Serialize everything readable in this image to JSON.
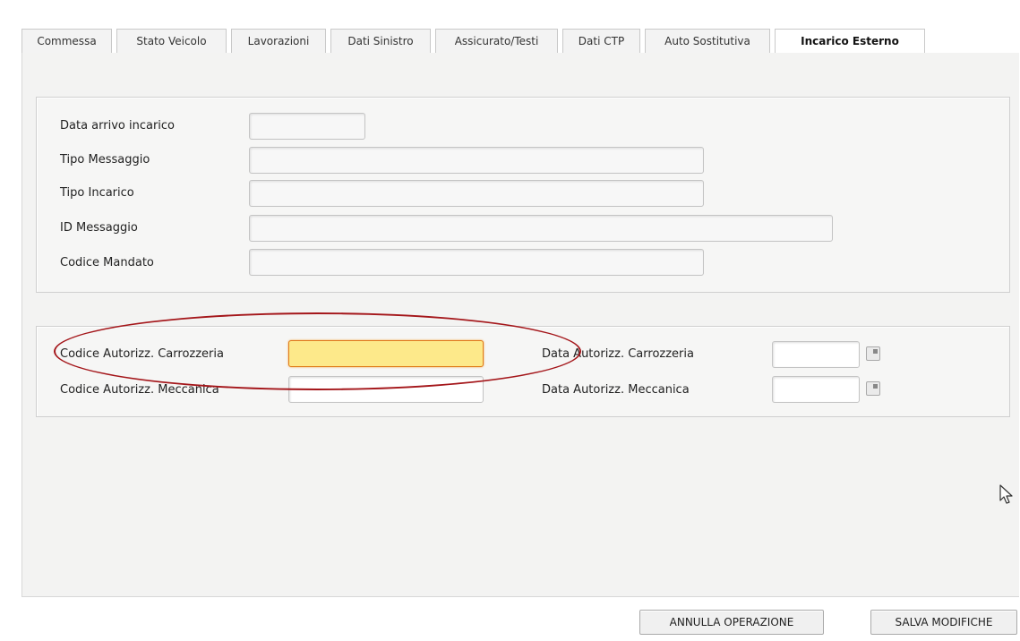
{
  "tabs": [
    {
      "label": "Commessa",
      "active": false
    },
    {
      "label": "Stato Veicolo",
      "active": false
    },
    {
      "label": "Lavorazioni",
      "active": false
    },
    {
      "label": "Dati Sinistro",
      "active": false
    },
    {
      "label": "Assicurato/Testi",
      "active": false
    },
    {
      "label": "Dati CTP",
      "active": false
    },
    {
      "label": "Auto Sostitutiva",
      "active": false
    },
    {
      "label": "Incarico Esterno",
      "active": true
    }
  ],
  "incarico": {
    "data_arrivo_label": "Data arrivo incarico",
    "data_arrivo_value": "",
    "tipo_messaggio_label": "Tipo Messaggio",
    "tipo_messaggio_value": "",
    "tipo_incarico_label": "Tipo Incarico",
    "tipo_incarico_value": "",
    "id_messaggio_label": "ID Messaggio",
    "id_messaggio_value": "",
    "codice_mandato_label": "Codice Mandato",
    "codice_mandato_value": ""
  },
  "autorizzazioni": {
    "codice_carrozzeria_label": "Codice Autorizz. Carrozzeria",
    "codice_carrozzeria_value": "",
    "codice_meccanica_label": "Codice Autorizz. Meccanica",
    "codice_meccanica_value": "",
    "data_carrozzeria_label": "Data Autorizz. Carrozzeria",
    "data_carrozzeria_value": "",
    "data_meccanica_label": "Data Autorizz. Meccanica",
    "data_meccanica_value": ""
  },
  "actions": {
    "annulla_label": "ANNULLA OPERAZIONE",
    "salva_label": "SALVA MODIFICHE"
  },
  "colors": {
    "focus_field": "#fde98a",
    "annotation_ellipse": "#a4161a"
  }
}
